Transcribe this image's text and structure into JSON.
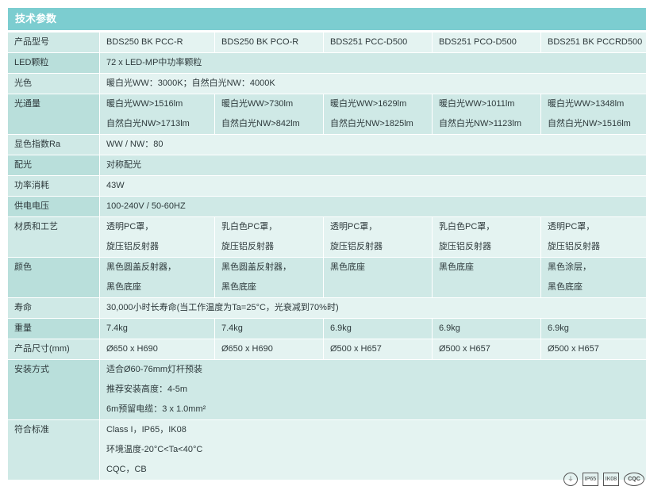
{
  "title": "技术参数",
  "rows": [
    {
      "label": "产品型号",
      "cells": [
        [
          "BDS250 BK PCC-R"
        ],
        [
          "BDS250 BK PCO-R"
        ],
        [
          "BDS251 PCC-D500"
        ],
        [
          "BDS251 PCO-D500"
        ],
        [
          "BDS251 BK PCCRD500"
        ]
      ]
    },
    {
      "label": "LED颗粒",
      "span": [
        "72 x LED-MP中功率颗粒"
      ]
    },
    {
      "label": "光色",
      "span": [
        "暖白光WW：3000K；自然白光NW：4000K"
      ]
    },
    {
      "label": "光通量",
      "cells": [
        [
          "暖白光WW>1516lm",
          "自然白光NW>1713lm"
        ],
        [
          "暖白光WW>730lm",
          "自然白光NW>842lm"
        ],
        [
          "暖白光WW>1629lm",
          "自然白光NW>1825lm"
        ],
        [
          "暖白光WW>1011lm",
          "自然白光NW>1123lm"
        ],
        [
          "暖白光WW>1348lm",
          "自然白光NW>1516lm"
        ]
      ]
    },
    {
      "label": "显色指数Ra",
      "span": [
        "WW / NW：80"
      ]
    },
    {
      "label": "配光",
      "span": [
        "对称配光"
      ]
    },
    {
      "label": "功率消耗",
      "span": [
        "43W"
      ]
    },
    {
      "label": "供电电压",
      "span": [
        "100-240V / 50-60HZ"
      ]
    },
    {
      "label": "材质和工艺",
      "cells": [
        [
          "透明PC罩，",
          "旋压铝反射器"
        ],
        [
          "乳白色PC罩，",
          "旋压铝反射器"
        ],
        [
          "透明PC罩，",
          "旋压铝反射器"
        ],
        [
          "乳白色PC罩，",
          "旋压铝反射器"
        ],
        [
          "透明PC罩，",
          "旋压铝反射器"
        ]
      ]
    },
    {
      "label": "颜色",
      "cells": [
        [
          "黑色圆盖反射器，",
          "黑色底座"
        ],
        [
          "黑色圆盖反射器，",
          "黑色底座"
        ],
        [
          "黑色底座"
        ],
        [
          "黑色底座"
        ],
        [
          "黑色涂层，",
          "黑色底座"
        ]
      ]
    },
    {
      "label": "寿命",
      "span": [
        "30,000小时长寿命(当工作温度为Ta=25°C，光衰减到70%时)"
      ]
    },
    {
      "label": "重量",
      "cells": [
        [
          "7.4kg"
        ],
        [
          "7.4kg"
        ],
        [
          "6.9kg"
        ],
        [
          "6.9kg"
        ],
        [
          "6.9kg"
        ]
      ]
    },
    {
      "label": "产品尺寸(mm)",
      "cells": [
        [
          "Ø650 x H690"
        ],
        [
          "Ø650 x H690"
        ],
        [
          "Ø500 x H657"
        ],
        [
          "Ø500 x H657"
        ],
        [
          "Ø500 x H657"
        ]
      ]
    },
    {
      "label": "安装方式",
      "span": [
        "适合Ø60-76mm灯杆预装",
        "推荐安装高度：4-5m",
        "6m预留电缆：3 x 1.0mm²"
      ]
    },
    {
      "label": "符合标准",
      "span": [
        "Class I，IP65，IK08",
        "环境温度-20°C<Ta<40°C",
        "CQC，CB"
      ]
    }
  ],
  "certifications": [
    {
      "icon": "ground-symbol-icon",
      "text": "⏚"
    },
    {
      "icon": "ip65-badge-icon",
      "text": "IP65"
    },
    {
      "icon": "ik08-badge-icon",
      "text": "IK08"
    },
    {
      "icon": "cqc-mark-icon",
      "text": "CQC"
    }
  ]
}
